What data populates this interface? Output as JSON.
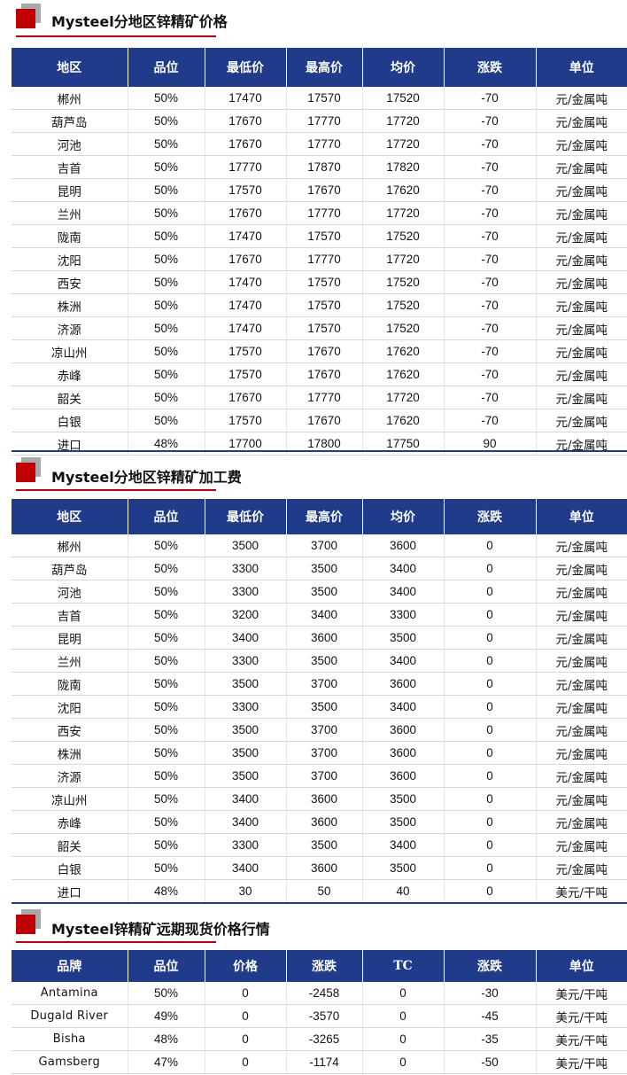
{
  "sections": [
    {
      "title": "Mysteel分地区锌精矿价格",
      "headers": [
        "地区",
        "品位",
        "最低价",
        "最高价",
        "均价",
        "涨跌",
        "单位"
      ],
      "rows": [
        [
          "郴州",
          "50%",
          "17470",
          "17570",
          "17520",
          "-70",
          "元/金属吨"
        ],
        [
          "葫芦岛",
          "50%",
          "17670",
          "17770",
          "17720",
          "-70",
          "元/金属吨"
        ],
        [
          "河池",
          "50%",
          "17670",
          "17770",
          "17720",
          "-70",
          "元/金属吨"
        ],
        [
          "吉首",
          "50%",
          "17770",
          "17870",
          "17820",
          "-70",
          "元/金属吨"
        ],
        [
          "昆明",
          "50%",
          "17570",
          "17670",
          "17620",
          "-70",
          "元/金属吨"
        ],
        [
          "兰州",
          "50%",
          "17670",
          "17770",
          "17720",
          "-70",
          "元/金属吨"
        ],
        [
          "陇南",
          "50%",
          "17470",
          "17570",
          "17520",
          "-70",
          "元/金属吨"
        ],
        [
          "沈阳",
          "50%",
          "17670",
          "17770",
          "17720",
          "-70",
          "元/金属吨"
        ],
        [
          "西安",
          "50%",
          "17470",
          "17570",
          "17520",
          "-70",
          "元/金属吨"
        ],
        [
          "株洲",
          "50%",
          "17470",
          "17570",
          "17520",
          "-70",
          "元/金属吨"
        ],
        [
          "济源",
          "50%",
          "17470",
          "17570",
          "17520",
          "-70",
          "元/金属吨"
        ],
        [
          "凉山州",
          "50%",
          "17570",
          "17670",
          "17620",
          "-70",
          "元/金属吨"
        ],
        [
          "赤峰",
          "50%",
          "17570",
          "17670",
          "17620",
          "-70",
          "元/金属吨"
        ],
        [
          "韶关",
          "50%",
          "17670",
          "17770",
          "17720",
          "-70",
          "元/金属吨"
        ],
        [
          "白银",
          "50%",
          "17570",
          "17670",
          "17620",
          "-70",
          "元/金属吨"
        ],
        [
          "进口",
          "48%",
          "17700",
          "17800",
          "17750",
          "90",
          "元/金属吨"
        ]
      ]
    },
    {
      "title": "Mysteel分地区锌精矿加工费",
      "headers": [
        "地区",
        "品位",
        "最低价",
        "最高价",
        "均价",
        "涨跌",
        "单位"
      ],
      "rows": [
        [
          "郴州",
          "50%",
          "3500",
          "3700",
          "3600",
          "0",
          "元/金属吨"
        ],
        [
          "葫芦岛",
          "50%",
          "3300",
          "3500",
          "3400",
          "0",
          "元/金属吨"
        ],
        [
          "河池",
          "50%",
          "3300",
          "3500",
          "3400",
          "0",
          "元/金属吨"
        ],
        [
          "吉首",
          "50%",
          "3200",
          "3400",
          "3300",
          "0",
          "元/金属吨"
        ],
        [
          "昆明",
          "50%",
          "3400",
          "3600",
          "3500",
          "0",
          "元/金属吨"
        ],
        [
          "兰州",
          "50%",
          "3300",
          "3500",
          "3400",
          "0",
          "元/金属吨"
        ],
        [
          "陇南",
          "50%",
          "3500",
          "3700",
          "3600",
          "0",
          "元/金属吨"
        ],
        [
          "沈阳",
          "50%",
          "3300",
          "3500",
          "3400",
          "0",
          "元/金属吨"
        ],
        [
          "西安",
          "50%",
          "3500",
          "3700",
          "3600",
          "0",
          "元/金属吨"
        ],
        [
          "株洲",
          "50%",
          "3500",
          "3700",
          "3600",
          "0",
          "元/金属吨"
        ],
        [
          "济源",
          "50%",
          "3500",
          "3700",
          "3600",
          "0",
          "元/金属吨"
        ],
        [
          "凉山州",
          "50%",
          "3400",
          "3600",
          "3500",
          "0",
          "元/金属吨"
        ],
        [
          "赤峰",
          "50%",
          "3400",
          "3600",
          "3500",
          "0",
          "元/金属吨"
        ],
        [
          "韶关",
          "50%",
          "3300",
          "3500",
          "3400",
          "0",
          "元/金属吨"
        ],
        [
          "白银",
          "50%",
          "3400",
          "3600",
          "3500",
          "0",
          "元/金属吨"
        ],
        [
          "进口",
          "48%",
          "30",
          "50",
          "40",
          "0",
          "美元/干吨"
        ]
      ]
    },
    {
      "title": "Mysteel锌精矿远期现货价格行情",
      "headers": [
        "品牌",
        "品位",
        "价格",
        "涨跌",
        "TC",
        "涨跌",
        "单位"
      ],
      "rows": [
        [
          "Antamina",
          "50%",
          "0",
          "-2458",
          "0",
          "-30",
          "美元/干吨"
        ],
        [
          "Dugald River",
          "49%",
          "0",
          "-3570",
          "0",
          "-45",
          "美元/干吨"
        ],
        [
          "Bisha",
          "48%",
          "0",
          "-3265",
          "0",
          "-35",
          "美元/干吨"
        ],
        [
          "Gamsberg",
          "47%",
          "0",
          "-1174",
          "0",
          "-50",
          "美元/干吨"
        ]
      ]
    }
  ],
  "colors": {
    "header_bg": "#1f3b8a",
    "accent_red": "#c00000",
    "negative_green": "#1a9e3a",
    "negative_red": "#e02020"
  }
}
